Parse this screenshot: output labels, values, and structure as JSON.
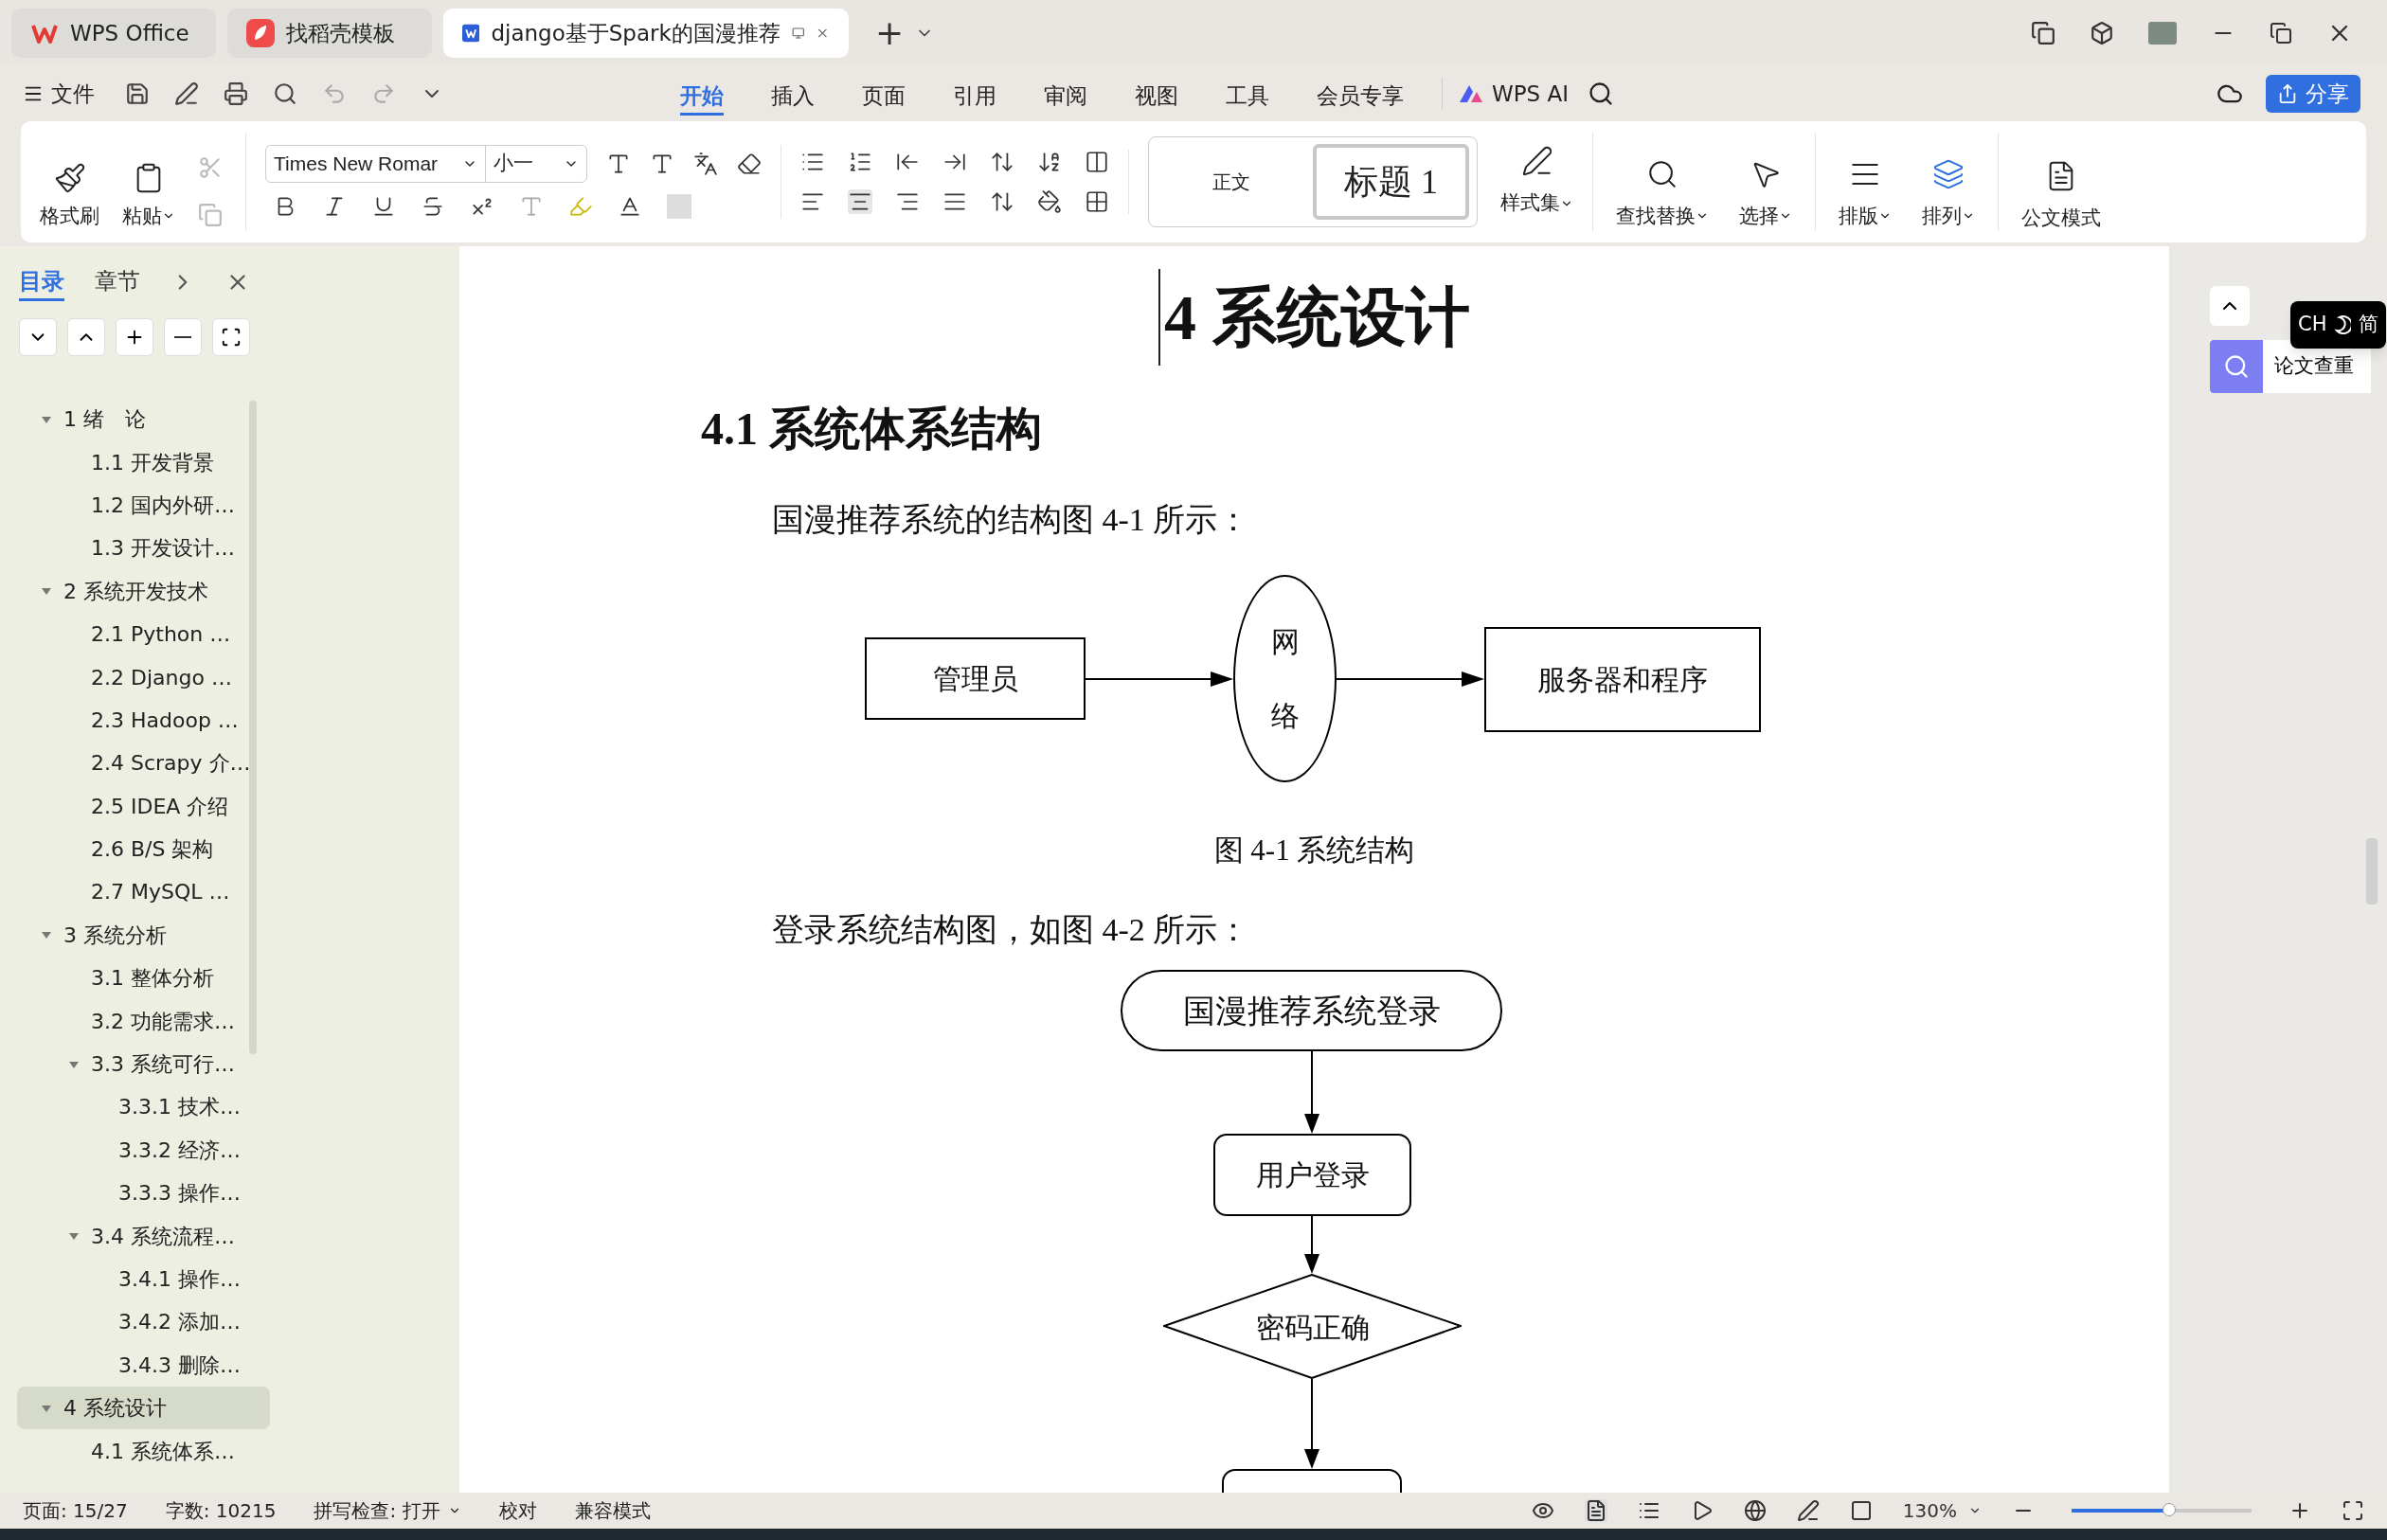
{
  "tabs": [
    {
      "label": "WPS Office",
      "kind": "home",
      "selected": false
    },
    {
      "label": "找稻壳模板",
      "kind": "template",
      "selected": false
    },
    {
      "label": "django基于Spark的国漫推荐",
      "kind": "document",
      "selected": true
    }
  ],
  "new_tab": "+",
  "menu": {
    "file": "文件",
    "items": [
      {
        "label": "开始",
        "selected": true
      },
      {
        "label": "插入",
        "selected": false
      },
      {
        "label": "页面",
        "selected": false
      },
      {
        "label": "引用",
        "selected": false
      },
      {
        "label": "审阅",
        "selected": false
      },
      {
        "label": "视图",
        "selected": false
      },
      {
        "label": "工具",
        "selected": false
      },
      {
        "label": "会员专享",
        "selected": false
      }
    ],
    "ai": "WPS AI",
    "share": "分享"
  },
  "ribbon": {
    "format_painter": "格式刷",
    "paste": "粘贴",
    "font": "Times New Romar",
    "size": "小一",
    "styles": [
      {
        "label": "正文",
        "selected": false
      },
      {
        "label": "标题  1",
        "selected": true
      }
    ],
    "style_set": "样式集",
    "find_replace": "查找替换",
    "select": "选择",
    "layout": "排版",
    "arrange": "排列",
    "official_mode": "公文模式"
  },
  "sidebar": {
    "tabs": [
      {
        "label": "目录",
        "selected": true
      },
      {
        "label": "章节",
        "selected": false
      }
    ],
    "toc": [
      {
        "label": "1  绪　论",
        "expanded": true,
        "selected": false,
        "children": [
          {
            "label": "1.1 开发背景",
            "selected": false
          },
          {
            "label": "1.2 国内外研…",
            "selected": false
          },
          {
            "label": "1.3 开发设计…",
            "selected": false
          }
        ]
      },
      {
        "label": "2  系统开发技术",
        "expanded": true,
        "selected": false,
        "children": [
          {
            "label": "2.1 Python …",
            "selected": false
          },
          {
            "label": "2.2 Django …",
            "selected": false
          },
          {
            "label": "2.3 Hadoop …",
            "selected": false
          },
          {
            "label": "2.4 Scrapy 介…",
            "selected": false
          },
          {
            "label": "2.5 IDEA 介绍",
            "selected": false
          },
          {
            "label": "2.6 B/S 架构",
            "selected": false
          },
          {
            "label": "2.7 MySQL …",
            "selected": false
          }
        ]
      },
      {
        "label": "3 系统分析",
        "expanded": true,
        "selected": false,
        "children": [
          {
            "label": "3.1 整体分析",
            "selected": false
          },
          {
            "label": "3.2 功能需求…",
            "selected": false
          },
          {
            "label": "3.3  系统可行…",
            "expanded": true,
            "selected": false,
            "children": [
              {
                "label": "3.3.1 技术…",
                "selected": false
              },
              {
                "label": "3.3.2 经济…",
                "selected": false
              },
              {
                "label": "3.3.3 操作…",
                "selected": false
              }
            ]
          },
          {
            "label": "3.4 系统流程…",
            "expanded": true,
            "selected": false,
            "children": [
              {
                "label": "3.4.1 操作…",
                "selected": false
              },
              {
                "label": "3.4.2 添加…",
                "selected": false
              },
              {
                "label": "3.4.3 删除…",
                "selected": false
              }
            ]
          }
        ]
      },
      {
        "label": "4  系统设计",
        "expanded": true,
        "selected": true,
        "children": [
          {
            "label": "4.1  系统体系…",
            "selected": false
          }
        ]
      }
    ]
  },
  "document": {
    "heading": "4  系统设计",
    "section": "4.1  系统体系结构",
    "paragraph_1": "国漫推荐系统的结构图 4-1 所示：",
    "figure_1": {
      "admin": "管理员",
      "network": "网络",
      "server": "服务器和程序"
    },
    "caption_1": "图 4-1  系统结构",
    "paragraph_2": "登录系统结构图，如图 4-2 所示：",
    "figure_2": {
      "start": "国漫推荐系统登录",
      "login": "用户登录",
      "check": "密码正确"
    }
  },
  "right_panel": {
    "plagiarism": "论文查重",
    "ime": "CH",
    "ime_mode": "简"
  },
  "status_bar": {
    "page": "页面: 15/27",
    "words": "字数: 10215",
    "spell": "拼写检查: 打开",
    "proofread": "校对",
    "compat": "兼容模式",
    "zoom": "130%",
    "zoom_slider": {
      "level": 0.54
    }
  }
}
